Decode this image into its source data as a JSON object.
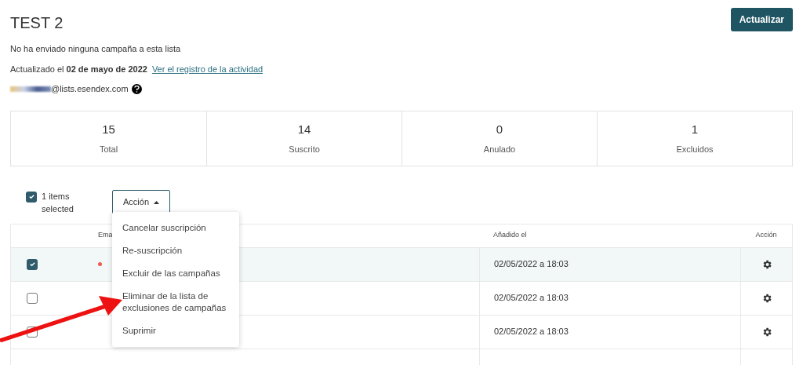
{
  "header": {
    "title": "TEST 2",
    "update_button": "Actualizar"
  },
  "info": {
    "campaigns": "No ha enviado ninguna campaña a esta lista",
    "updated": "Actualizado el **02 de mayo de 2022**",
    "activity_link": "Ver el registro de la actividad",
    "email": "@lists.esendex.com"
  },
  "stats": [
    {
      "value": "15",
      "label": "Total"
    },
    {
      "value": "14",
      "label": "Suscrito"
    },
    {
      "value": "0",
      "label": "Anulado"
    },
    {
      "value": "1",
      "label": "Excluidos"
    }
  ],
  "bulk": {
    "checked": true,
    "label": "1 items selected",
    "action_button": "Acción",
    "expanded": true
  },
  "menu": [
    "Cancelar suscripción",
    "Re-suscripción",
    "Excluir de las campañas",
    "Eliminar de la lista de exclusiones de campañas",
    "Suprimir"
  ],
  "table": {
    "columns": [
      "Ema",
      "Añadido el",
      "Acción"
    ],
    "rows": [
      {
        "selected": true,
        "flagged": true,
        "added": "02/05/2022 a 18:03"
      },
      {
        "selected": false,
        "flagged": false,
        "added": "02/05/2022 a 18:03"
      },
      {
        "selected": false,
        "flagged": false,
        "added": "02/05/2022 a 18:03"
      }
    ]
  }
}
